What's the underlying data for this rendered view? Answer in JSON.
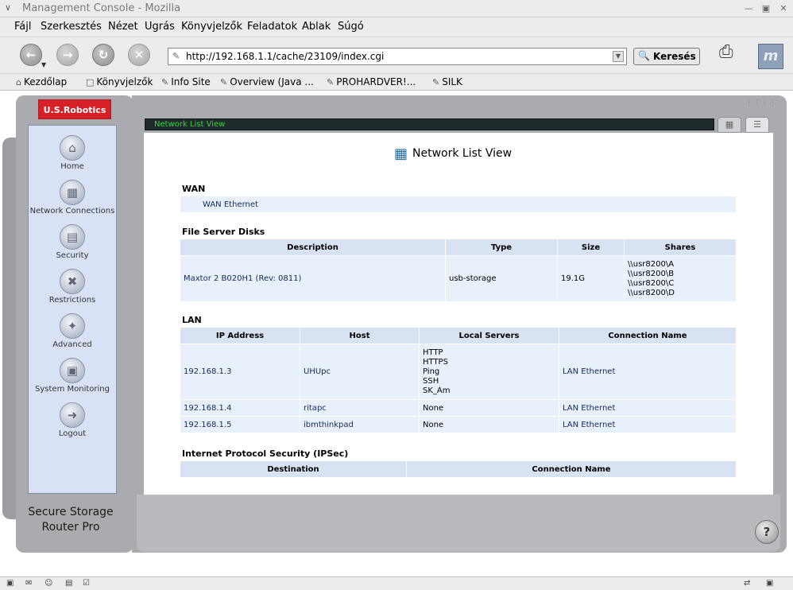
{
  "window": {
    "title": "Management Console - Mozilla"
  },
  "menu": [
    "Fájl",
    "Szerkesztés",
    "Nézet",
    "Ugrás",
    "Könyvjelzők",
    "Feladatok",
    "Ablak",
    "Súgó"
  ],
  "nav": {
    "url": "http://192.168.1.1/cache/23109/index.cgi",
    "search_label": "Keresés"
  },
  "bookmarks": [
    "Kezdőlap",
    "Könyvjelzők",
    "Info Site",
    "Overview (Java ...",
    "PROHARDVER!...",
    "SILK"
  ],
  "sidebar": {
    "logo": "U.S.Robotics",
    "items": [
      {
        "label": "Home",
        "icon": "home-icon"
      },
      {
        "label": "Network Connections",
        "icon": "network-icon"
      },
      {
        "label": "Security",
        "icon": "lock-icon"
      },
      {
        "label": "Restrictions",
        "icon": "restrictions-icon"
      },
      {
        "label": "Advanced",
        "icon": "tools-icon"
      },
      {
        "label": "System Monitoring",
        "icon": "monitor-icon"
      },
      {
        "label": "Logout",
        "icon": "logout-icon"
      }
    ],
    "product_line1": "Secure Storage",
    "product_line2": "Router Pro"
  },
  "panel": {
    "title_bar": "Network List View",
    "heading": "Network List View",
    "wan": {
      "heading": "WAN",
      "items": [
        "WAN Ethernet"
      ]
    },
    "disks": {
      "heading": "File Server Disks",
      "columns": [
        "Description",
        "Type",
        "Size",
        "Shares"
      ],
      "rows": [
        {
          "description": "Maxtor 2 B020H1 (Rev: 0811)",
          "type": "usb-storage",
          "size": "19.1G",
          "shares": [
            "\\\\usr8200\\A",
            "\\\\usr8200\\B",
            "\\\\usr8200\\C",
            "\\\\usr8200\\D"
          ]
        }
      ]
    },
    "lan": {
      "heading": "LAN",
      "columns": [
        "IP Address",
        "Host",
        "Local Servers",
        "Connection Name"
      ],
      "rows": [
        {
          "ip": "192.168.1.3",
          "host": "UHUpc",
          "servers": [
            "HTTP",
            "HTTPS",
            "Ping",
            "SSH",
            "SK_Am"
          ],
          "connection": "LAN Ethernet"
        },
        {
          "ip": "192.168.1.4",
          "host": "ritapc",
          "servers": [
            "None"
          ],
          "connection": "LAN Ethernet"
        },
        {
          "ip": "192.168.1.5",
          "host": "ibmthinkpad",
          "servers": [
            "None"
          ],
          "connection": "LAN Ethernet"
        }
      ]
    },
    "ipsec": {
      "heading": "Internet Protocol Security (IPSec)",
      "columns": [
        "Destination",
        "Connection Name"
      ]
    }
  },
  "colors": {
    "brand_red": "#d62027",
    "sidebar_bg": "#d8e1f6",
    "frame_gray": "#a9abae",
    "title_bar_text": "#37d63a",
    "cell_bg": "#e8f0fb",
    "header_bg": "#d7e3f2"
  }
}
